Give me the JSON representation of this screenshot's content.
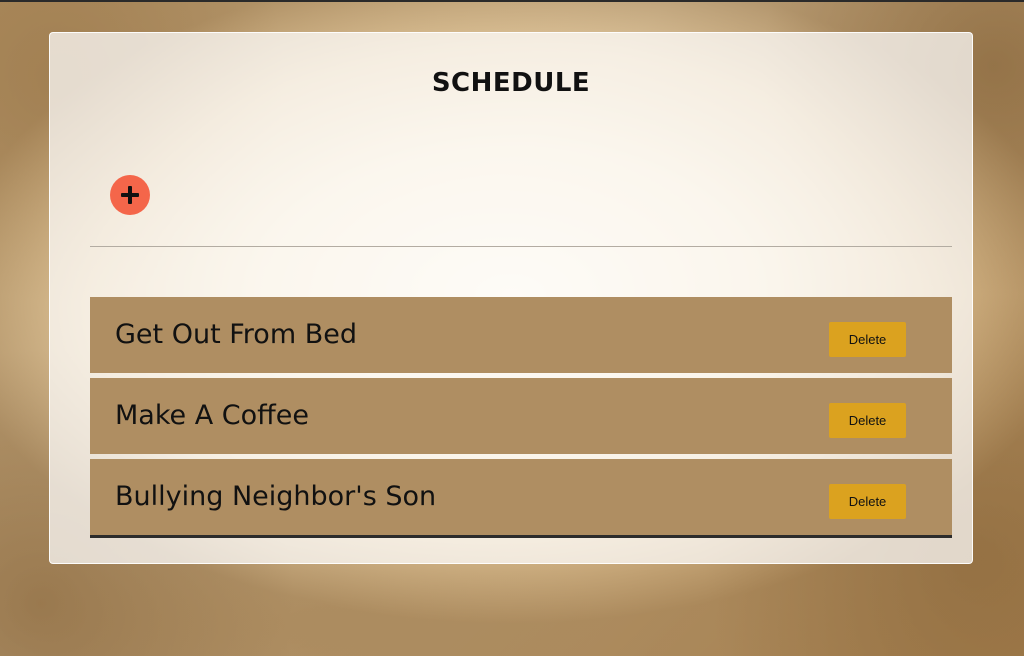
{
  "app": {
    "title": "SCHEDULE"
  },
  "toolbar": {
    "add_icon": "plus-icon",
    "add_color": "#f4664a"
  },
  "schedule": {
    "items": [
      {
        "label": "Get Out From Bed",
        "delete_label": "Delete"
      },
      {
        "label": "Make A Coffee",
        "delete_label": "Delete"
      },
      {
        "label": "Bullying Neighbor's Son",
        "delete_label": "Delete"
      }
    ]
  },
  "colors": {
    "item_background": "#af8e62",
    "delete_button": "#dba21f",
    "text": "#111111"
  }
}
